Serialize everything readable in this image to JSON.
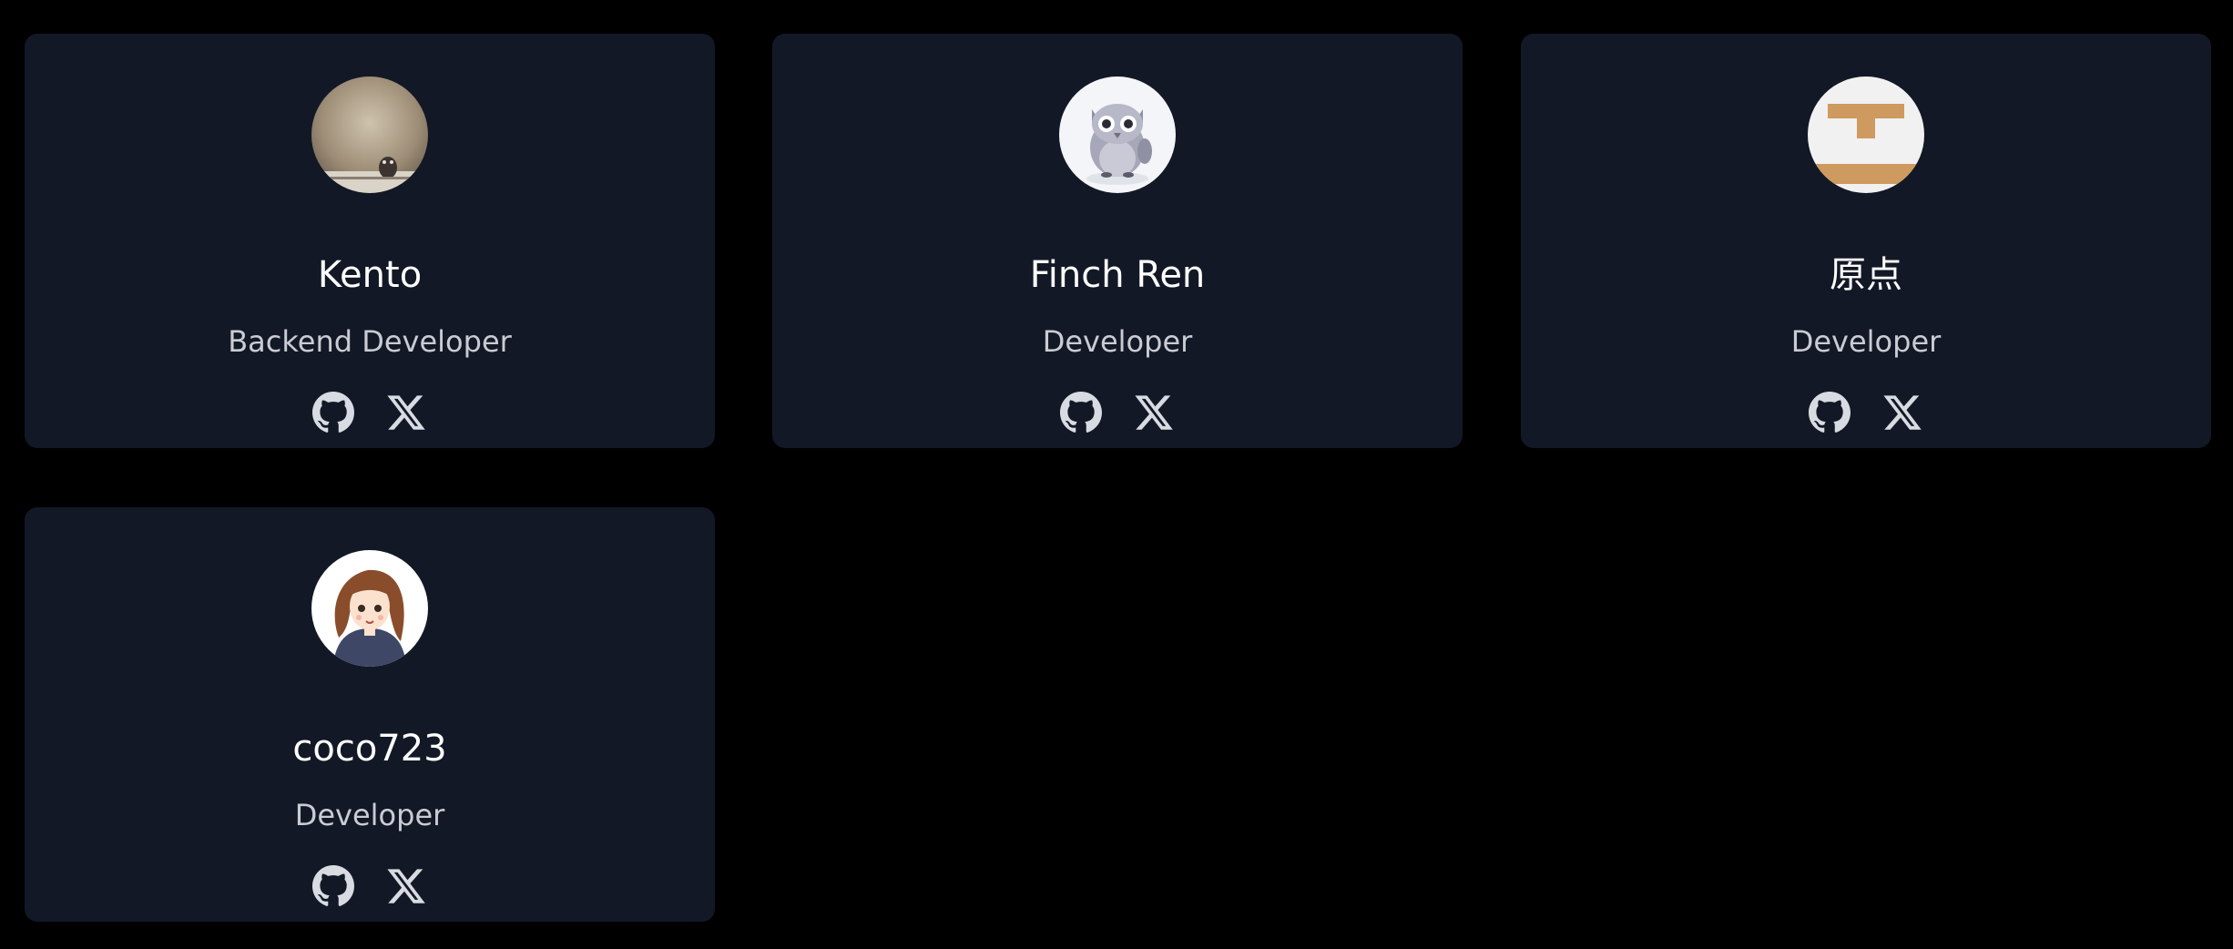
{
  "team": {
    "members": [
      {
        "name": "Kento",
        "role": "Backend Developer",
        "avatar": "photo-cat-avatar"
      },
      {
        "name": "Finch Ren",
        "role": "Developer",
        "avatar": "owl-avatar"
      },
      {
        "name": "原点",
        "role": "Developer",
        "avatar": "orange-t-logo-avatar"
      },
      {
        "name": "coco723",
        "role": "Developer",
        "avatar": "illustrated-girl-avatar"
      }
    ],
    "socials": [
      "github-icon",
      "x-icon"
    ]
  },
  "colors": {
    "background": "#000000",
    "card": "#131826",
    "name_text": "#ffffff",
    "role_text": "#c9ccd3",
    "icon": "#d8dbe2"
  }
}
